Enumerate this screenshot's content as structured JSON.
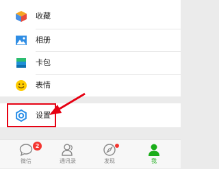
{
  "menu": {
    "items": [
      {
        "label": "收藏",
        "icon": "favorites-cube-icon"
      },
      {
        "label": "相册",
        "icon": "album-icon"
      },
      {
        "label": "卡包",
        "icon": "card-wallet-icon"
      },
      {
        "label": "表情",
        "icon": "emoji-icon"
      }
    ],
    "settings": {
      "label": "设置",
      "icon": "settings-gear-icon"
    }
  },
  "tabbar": {
    "tabs": [
      {
        "label": "微信",
        "icon": "chat-bubble-icon",
        "badge": "2"
      },
      {
        "label": "通讯录",
        "icon": "contacts-icon"
      },
      {
        "label": "发现",
        "icon": "compass-icon"
      },
      {
        "label": "我",
        "icon": "me-person-icon",
        "active": true
      }
    ]
  },
  "colors": {
    "accent_green": "#1aad19",
    "highlight_red": "#e60012",
    "badge_red": "#f43530"
  }
}
